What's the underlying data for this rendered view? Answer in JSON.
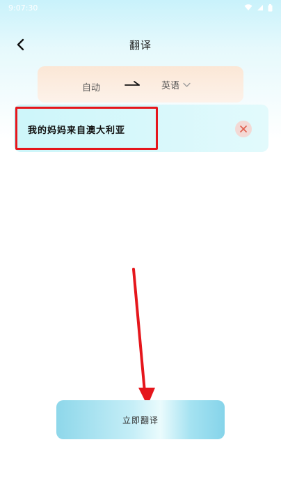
{
  "status_bar": {
    "time": "9:07:30",
    "icons": [
      "wifi-icon",
      "signal-icon",
      "battery-icon"
    ]
  },
  "header": {
    "title": "翻译",
    "back_icon": "chevron-left-icon"
  },
  "language_selector": {
    "source": "自动",
    "arrow_icon": "arrow-right-icon",
    "target": "英语",
    "dropdown_icon": "chevron-down-icon"
  },
  "input": {
    "text": "我的妈妈来自澳大利亚",
    "clear_icon": "close-icon"
  },
  "action": {
    "translate_label": "立即翻译"
  },
  "colors": {
    "highlight": "#e5161c",
    "clear_bg": "#f3d9d5",
    "clear_x": "#e0604f"
  }
}
